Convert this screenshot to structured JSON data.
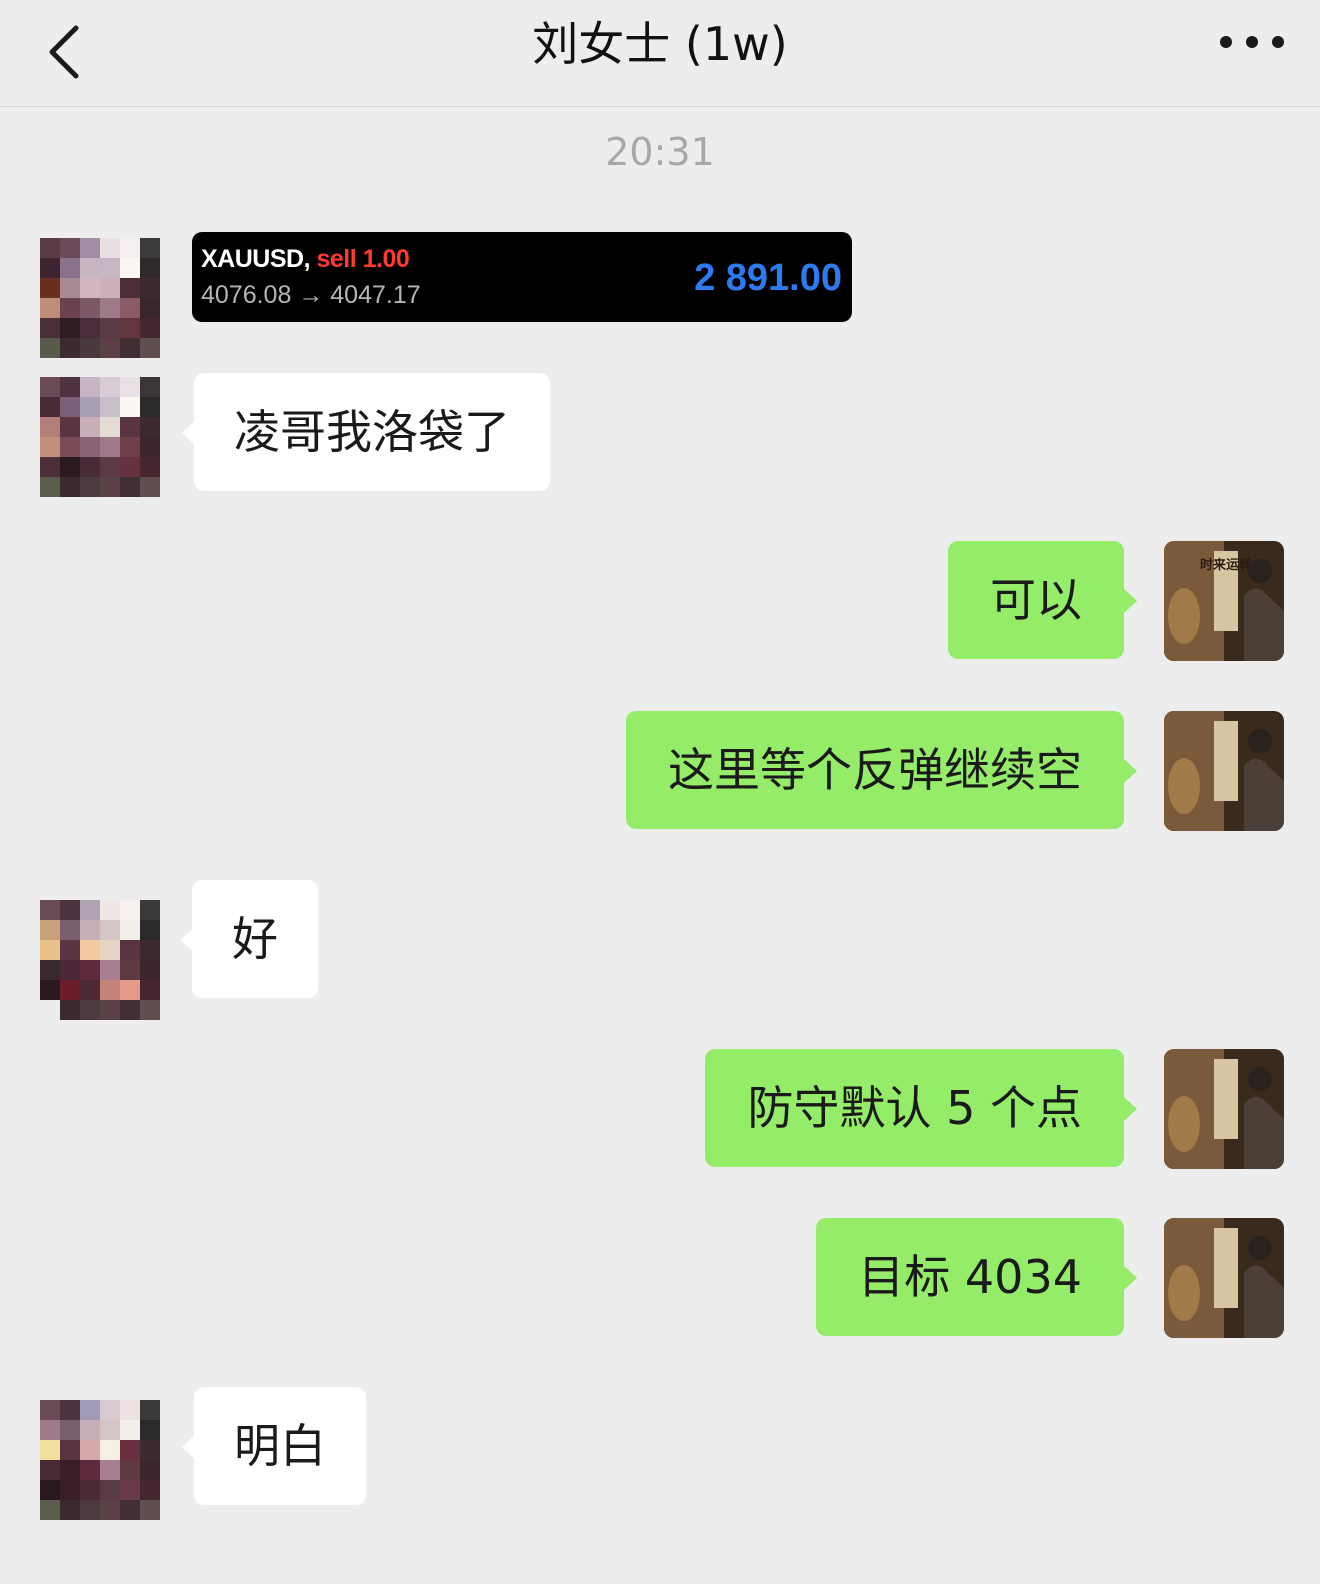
{
  "header": {
    "title": "刘女士 (1w)"
  },
  "timestamp": "20:31",
  "messages": [
    {
      "side": "left",
      "type": "trade-card",
      "symbol": "XAUUSD,",
      "action": "sell 1.00",
      "prices": "4076.08 → 4047.17",
      "profit": "2 891.00"
    },
    {
      "side": "left",
      "text": "凌哥我洛袋了"
    },
    {
      "side": "right",
      "text": "可以"
    },
    {
      "side": "right",
      "text": "这里等个反弹继续空"
    },
    {
      "side": "left",
      "text": "好"
    },
    {
      "side": "right",
      "text": "防守默认 5 个点"
    },
    {
      "side": "right",
      "text": "目标 4034"
    },
    {
      "side": "left",
      "text": "明白"
    }
  ],
  "self_avatar_text": "时来运转",
  "colors": {
    "background": "#ededed",
    "outgoing_bubble": "#95ec69",
    "incoming_bubble": "#ffffff",
    "trade_sell": "#ff3b30",
    "trade_profit": "#2d7bf0"
  }
}
